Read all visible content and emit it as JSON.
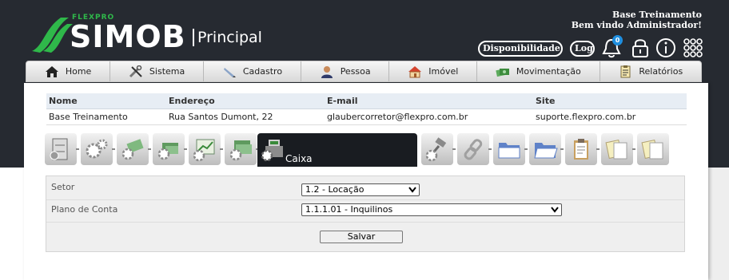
{
  "header": {
    "brand_small": "FLEXPRO",
    "brand_main": "SIMOB",
    "brand_section": "Principal",
    "company": "Base Treinamento",
    "welcome": "Bem vindo Administrador!",
    "availability_label": "Disponibilidade",
    "log_label": "Log",
    "notification_count": "0",
    "icons": [
      "bell-icon",
      "lock-icon",
      "info-icon",
      "apps-grid-icon"
    ]
  },
  "menu": [
    {
      "label": "Home",
      "icon": "home-icon"
    },
    {
      "label": "Sistema",
      "icon": "tools-icon"
    },
    {
      "label": "Cadastro",
      "icon": "pen-icon"
    },
    {
      "label": "Pessoa",
      "icon": "person-icon"
    },
    {
      "label": "Imóvel",
      "icon": "house-icon"
    },
    {
      "label": "Movimentação",
      "icon": "money-icon"
    },
    {
      "label": "Relatórios",
      "icon": "report-icon"
    }
  ],
  "info_table": {
    "headers": [
      "Nome",
      "Endereço",
      "E-mail",
      "Site"
    ],
    "row": [
      "Base Treinamento",
      "Rua Santos Dumont, 22",
      "glaubercorretor@flexpro.com.br",
      "suporte.flexpro.com.br"
    ]
  },
  "tabs": {
    "active_label": "Caixa",
    "icons": [
      "cabinet-gear-icon",
      "gears-icon",
      "money-gear-icon",
      "cash-gear-icon",
      "chart-gear-icon",
      "bills-gear-icon",
      "cash-register-icon",
      "gavel-gear-icon",
      "link-gear-icon",
      "folder-icon",
      "folder-open-icon",
      "clipboard-icon",
      "papers-icon",
      "papers-icon-2"
    ]
  },
  "form": {
    "setor_label": "Setor",
    "setor_value": "1.2 - Locação",
    "plano_label": "Plano de Conta",
    "plano_value": "1.1.1.01 - Inquilinos",
    "save_label": "Salvar"
  },
  "colors": {
    "header_bg": "#262a31",
    "brand_green": "#2fb84a",
    "badge_blue": "#1f8fe0",
    "active_tab": "#191c21"
  }
}
